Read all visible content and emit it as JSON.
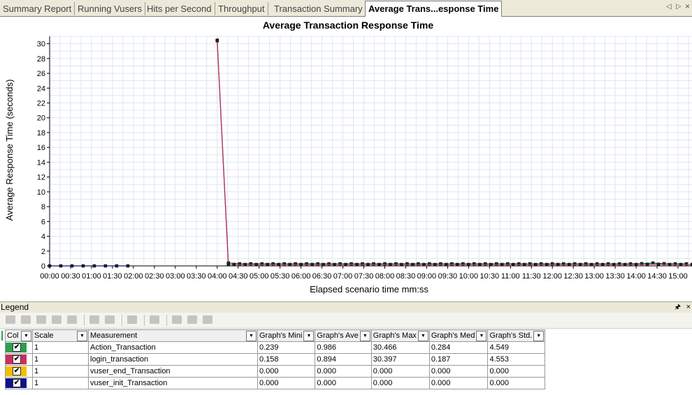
{
  "tabs": [
    {
      "label": "Summary Report",
      "active": false
    },
    {
      "label": "Running Vusers",
      "active": false
    },
    {
      "label": "Hits per Second",
      "active": false
    },
    {
      "label": "Throughput",
      "active": false
    },
    {
      "label": "Transaction Summary",
      "active": false
    },
    {
      "label": "Average Trans...esponse Time",
      "active": true
    }
  ],
  "tab_nav": {
    "prev": "◁",
    "next": "▷",
    "close": "×"
  },
  "chart_data": {
    "type": "line",
    "title": "Average Transaction Response Time",
    "xlabel": "Elapsed scenario time mm:ss",
    "ylabel": "Average Response Time (seconds)",
    "ylim": [
      0,
      31
    ],
    "xlim_seconds": [
      0,
      920
    ],
    "y_ticks": [
      0,
      2,
      4,
      6,
      8,
      10,
      12,
      14,
      16,
      18,
      20,
      22,
      24,
      26,
      28,
      30
    ],
    "x_tick_labels": [
      "00:00",
      "00:30",
      "01:00",
      "01:30",
      "02:00",
      "02:30",
      "03:00",
      "03:30",
      "04:00",
      "04:30",
      "05:00",
      "05:30",
      "06:00",
      "06:30",
      "07:00",
      "07:30",
      "08:00",
      "08:30",
      "09:00",
      "09:30",
      "10:00",
      "10:30",
      "11:00",
      "11:30",
      "12:00",
      "12:30",
      "13:00",
      "13:30",
      "14:00",
      "14:30",
      "15:00"
    ],
    "grid": true,
    "series": [
      {
        "name": "Action_Transaction",
        "color": "#208040",
        "x": [
          240,
          256,
          272,
          288,
          304,
          320,
          336,
          352,
          368,
          384,
          400,
          416,
          432,
          448,
          464,
          480,
          496,
          512,
          528,
          544,
          560,
          576,
          592,
          608,
          624,
          640,
          656,
          672,
          688,
          704,
          720,
          736,
          752,
          768,
          784,
          800,
          816,
          832,
          848,
          864,
          880,
          896,
          912
        ],
        "y": [
          30.47,
          0.4,
          0.28,
          0.28,
          0.28,
          0.28,
          0.28,
          0.28,
          0.28,
          0.28,
          0.28,
          0.28,
          0.28,
          0.28,
          0.28,
          0.28,
          0.28,
          0.28,
          0.28,
          0.28,
          0.28,
          0.28,
          0.28,
          0.28,
          0.28,
          0.28,
          0.28,
          0.28,
          0.28,
          0.28,
          0.28,
          0.28,
          0.28,
          0.28,
          0.28,
          0.28,
          0.28,
          0.28,
          0.3,
          0.38,
          0.3,
          0.28,
          0.28
        ]
      },
      {
        "name": "login_transaction",
        "color": "#c03060",
        "x": [
          240,
          256,
          264,
          280,
          296,
          312,
          328,
          344,
          360,
          376,
          392,
          408,
          424,
          440,
          456,
          472,
          488,
          504,
          520,
          536,
          552,
          568,
          584,
          600,
          616,
          632,
          648,
          664,
          680,
          696,
          712,
          728,
          744,
          760,
          776,
          792,
          808,
          824,
          840,
          856,
          872,
          888,
          904,
          920
        ],
        "y": [
          30.4,
          0.19,
          0.19,
          0.19,
          0.19,
          0.19,
          0.19,
          0.19,
          0.19,
          0.19,
          0.19,
          0.19,
          0.19,
          0.19,
          0.19,
          0.19,
          0.19,
          0.19,
          0.19,
          0.19,
          0.19,
          0.19,
          0.19,
          0.19,
          0.19,
          0.19,
          0.19,
          0.19,
          0.19,
          0.19,
          0.19,
          0.19,
          0.19,
          0.19,
          0.19,
          0.19,
          0.19,
          0.19,
          0.19,
          0.22,
          0.22,
          0.19,
          0.19,
          0.19
        ]
      },
      {
        "name": "vuser_end_Transaction",
        "color": "#e8c000",
        "x": [],
        "y": []
      },
      {
        "name": "vuser_init_Transaction",
        "color": "#101080",
        "x": [
          0,
          16,
          32,
          48,
          64,
          80,
          96,
          112
        ],
        "y": [
          0,
          0,
          0,
          0,
          0,
          0,
          0,
          0
        ]
      }
    ]
  },
  "legend": {
    "title": "Legend",
    "pin": "📌",
    "close": "×",
    "columns": [
      "Col",
      "Scale",
      "Measurement",
      "Graph's Mini",
      "Graph's Ave",
      "Graph's Max",
      "Graph's Med",
      "Graph's Std."
    ],
    "rows": [
      {
        "color": "#2e9e4e",
        "scale": "1",
        "measurement": "Action_Transaction",
        "min": "0.239",
        "avg": "0.986",
        "max": "30.466",
        "med": "0.284",
        "std": "4.549"
      },
      {
        "color": "#c8305e",
        "scale": "1",
        "measurement": "login_transaction",
        "min": "0.158",
        "avg": "0.894",
        "max": "30.397",
        "med": "0.187",
        "std": "4.553"
      },
      {
        "color": "#f0c000",
        "scale": "1",
        "measurement": "vuser_end_Transaction",
        "min": "0.000",
        "avg": "0.000",
        "max": "0.000",
        "med": "0.000",
        "std": "0.000"
      },
      {
        "color": "#101088",
        "scale": "1",
        "measurement": "vuser_init_Transaction",
        "min": "0.000",
        "avg": "0.000",
        "max": "0.000",
        "med": "0.000",
        "std": "0.000"
      }
    ],
    "check_mark": "✔",
    "dropdown_glyph": "▼"
  }
}
